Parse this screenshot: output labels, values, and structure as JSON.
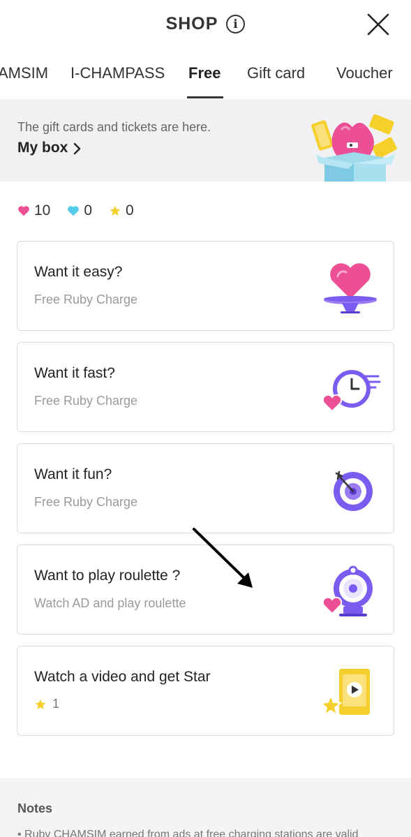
{
  "header": {
    "title": "SHOP",
    "info_glyph": "i"
  },
  "tabs": [
    {
      "label": "AMSIM"
    },
    {
      "label": "I-CHAMPASS"
    },
    {
      "label": "Free"
    },
    {
      "label": "Gift card"
    },
    {
      "label": "Voucher"
    }
  ],
  "active_tab": "Free",
  "banner": {
    "subtitle": "The gift cards and tickets are here.",
    "link_label": "My box"
  },
  "currency": {
    "ruby": "10",
    "blue": "0",
    "star": "0"
  },
  "cards": [
    {
      "title": "Want it easy?",
      "subtitle": "Free Ruby Charge",
      "icon": "heart-plate-icon"
    },
    {
      "title": "Want it fast?",
      "subtitle": "Free Ruby Charge",
      "icon": "fast-clock-icon"
    },
    {
      "title": "Want it fun?",
      "subtitle": "Free Ruby Charge",
      "icon": "target-icon"
    },
    {
      "title": "Want to play roulette ?",
      "subtitle": "Watch AD and play roulette",
      "icon": "roulette-icon"
    },
    {
      "title": "Watch a video and get Star",
      "star_count": "1",
      "icon": "video-star-icon"
    }
  ],
  "notes": {
    "title": "Notes",
    "line": "• Ruby CHAMSIM earned from ads at free charging stations are valid"
  },
  "colors": {
    "ruby": "#ec4f96",
    "blue": "#55ccec",
    "star": "#f5cf2b",
    "purple": "#7b5cf0",
    "banner_bg": "#f1f1f3"
  }
}
